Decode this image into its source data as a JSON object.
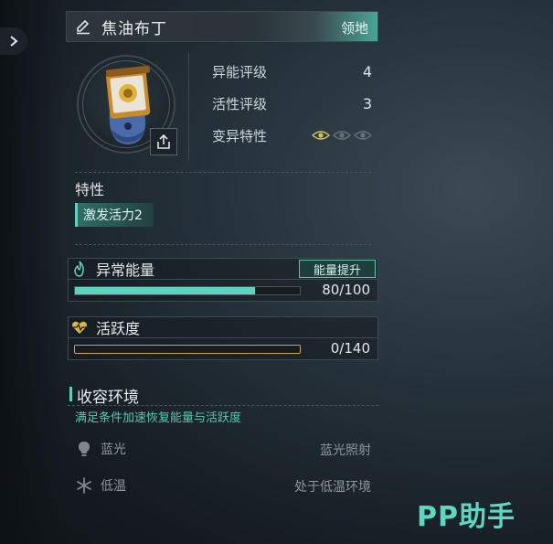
{
  "header": {
    "title": "焦油布丁",
    "tag": "领地"
  },
  "stats": [
    {
      "label": "异能评级",
      "value": "4"
    },
    {
      "label": "活性评级",
      "value": "3"
    },
    {
      "label": "变异特性",
      "eyes_active": 1,
      "eyes_total": 3
    }
  ],
  "traits": {
    "label": "特性",
    "items": [
      "激发活力2"
    ]
  },
  "energy": {
    "title": "异常能量",
    "boost_label": "能量提升",
    "value_text": "80/100",
    "fraction": 0.8,
    "color": "#5fd2bf"
  },
  "activity": {
    "title": "活跃度",
    "value_text": "0/140",
    "fraction": 0.0,
    "color": "#c9a64a"
  },
  "containment": {
    "title": "收容环境",
    "description": "满足条件加速恢复能量与活跃度",
    "conditions": [
      {
        "icon": "bulb-icon",
        "name": "蓝光",
        "state": "蓝光照射"
      },
      {
        "icon": "snowflake-icon",
        "name": "低温",
        "state": "处于低温环境"
      }
    ]
  },
  "watermark": "PP助手",
  "colors": {
    "accent": "#5fd2bf",
    "gold": "#c9a64a",
    "eye_active": "#d6c25a",
    "eye_inactive": "#6a7378"
  }
}
